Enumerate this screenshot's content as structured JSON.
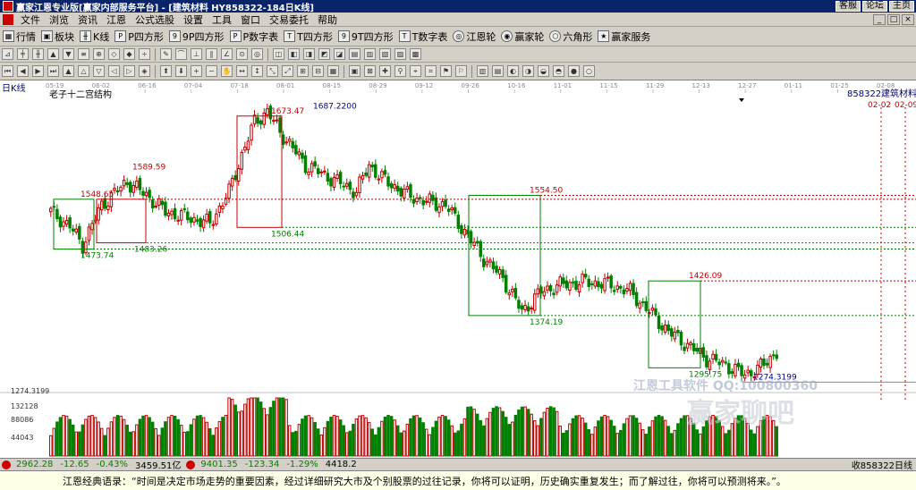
{
  "titlebar": {
    "title": "赢家江恩专业版[赢家内部服务平台] - [建筑材料  HY858322-184日K线]",
    "links": [
      "客服",
      "论坛",
      "主页"
    ]
  },
  "menubar": {
    "items": [
      "文件",
      "浏览",
      "资讯",
      "江恩",
      "公式选股",
      "设置",
      "工具",
      "窗口",
      "交易委托",
      "帮助"
    ],
    "win_buttons": [
      "_",
      "□",
      "×"
    ]
  },
  "toolbar1": {
    "items": [
      {
        "icon": "grid-icon",
        "label": "行情"
      },
      {
        "icon": "block-icon",
        "label": "板块"
      },
      {
        "icon": "kline-icon",
        "label": "K线"
      },
      {
        "icon": "p-square-icon",
        "label": "P四方形"
      },
      {
        "icon": "9p-square-icon",
        "label": "9P四方形"
      },
      {
        "icon": "p-number-icon",
        "label": "P数字表"
      },
      {
        "icon": "t-square-icon",
        "label": "T四方形"
      },
      {
        "icon": "9t-square-icon",
        "label": "9T四方形"
      },
      {
        "icon": "t-number-icon",
        "label": "T数字表"
      },
      {
        "icon": "gann-wheel-icon",
        "label": "江恩轮"
      },
      {
        "icon": "winner-wheel-icon",
        "label": "赢家轮"
      },
      {
        "icon": "hexagon-icon",
        "label": "六角形"
      },
      {
        "icon": "service-icon",
        "label": "赢家服务"
      }
    ]
  },
  "chart_header": {
    "period": "日K线",
    "subtitle": "老子十二宫结构",
    "code": "858322",
    "name": "建筑材料",
    "date_label1": "02-02",
    "date_label2": "02-09"
  },
  "chart_data": {
    "type": "candlestick",
    "x_ticks": [
      "05-19",
      "06-02",
      "06-16",
      "07-04",
      "07-18",
      "08-01",
      "08-15",
      "08-29",
      "09-12",
      "09-26",
      "10-16",
      "11-01",
      "11-15",
      "11-29",
      "12-13",
      "12-27",
      "01-11",
      "01-25",
      "02-08"
    ],
    "price_labels": [
      {
        "text": "1548.65",
        "color": "#c00000"
      },
      {
        "text": "1589.59",
        "color": "#c00000"
      },
      {
        "text": "1673.47",
        "color": "#c00000"
      },
      {
        "text": "1687.2200",
        "color": "#000080"
      },
      {
        "text": "1506.44",
        "color": "#008000"
      },
      {
        "text": "1473.74",
        "color": "#008000"
      },
      {
        "text": "1483.26",
        "color": "#008000"
      },
      {
        "text": "1554.50",
        "color": "#c00000"
      },
      {
        "text": "1374.19",
        "color": "#008000"
      },
      {
        "text": "1426.09",
        "color": "#c00000"
      },
      {
        "text": "1295.75",
        "color": "#008000"
      },
      {
        "text": "1274.3199",
        "color": "#000080"
      }
    ],
    "volume_labels": [
      "1274.3199",
      "132128",
      "88086",
      "44043"
    ],
    "watermark": "江恩工具软件 QQ:100800360",
    "watermark2": "赢家聊吧"
  },
  "statusbar": {
    "index1_value": "2962.28",
    "index1_change": "-12.65",
    "index1_pct": "-0.43%",
    "index1_amount": "3459.51亿",
    "index2_value": "9401.35",
    "index2_change": "-123.34",
    "index2_pct": "-1.29%",
    "index2_amount": "4418.2",
    "right_label": "收858322日线"
  },
  "quotebar": {
    "text": "江恩经典语录：“时间是决定市场走势的重要因素，经过详细研究大市及个别股票的过往记录，你将可以证明，历史确实重复发生；而了解过往，你将可以预测将来。”。"
  }
}
